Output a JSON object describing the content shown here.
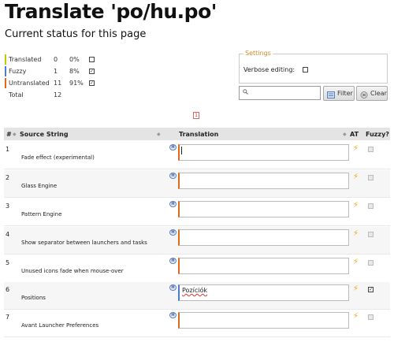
{
  "page": {
    "title": "Translate 'po/hu.po'",
    "subtitle": "Current status for this page"
  },
  "stats": [
    {
      "label": "Translated",
      "count": "0",
      "percent": "0%",
      "checked": "",
      "color": "#c8c800"
    },
    {
      "label": "Fuzzy",
      "count": "1",
      "percent": "8%",
      "checked": "✓",
      "color": "#4a7fd0"
    },
    {
      "label": "Untranslated",
      "count": "11",
      "percent": "91%",
      "checked": "✓",
      "color": "#e06a1a"
    },
    {
      "label": "Total",
      "count": "12",
      "percent": "",
      "checked": "",
      "color": ""
    }
  ],
  "settings": {
    "legend": "Settings",
    "verbose_label": "Verbose editing:"
  },
  "search": {
    "placeholder": "",
    "icon": "search-icon"
  },
  "buttons": {
    "filter": "Filter",
    "clear": "Clear"
  },
  "pager": {
    "current_page": "1"
  },
  "table": {
    "headers": {
      "num": "#",
      "source": "Source String",
      "translation": "Translation",
      "at": "AT",
      "fuzzy": "Fuzzy?"
    },
    "rows": [
      {
        "num": "1",
        "source": "Fade effect (experimental)",
        "translation": "",
        "fuzzy": ""
      },
      {
        "num": "2",
        "source": "Glass Engine",
        "translation": "",
        "fuzzy": ""
      },
      {
        "num": "3",
        "source": "Pattern Engine",
        "translation": "",
        "fuzzy": ""
      },
      {
        "num": "4",
        "source": "Show separator between launchers and tasks",
        "translation": "",
        "fuzzy": ""
      },
      {
        "num": "5",
        "source": "Unused icons fade when mouse-over",
        "translation": "",
        "fuzzy": ""
      },
      {
        "num": "6",
        "source": "Positions",
        "translation": "Pozíciók",
        "fuzzy": "✓"
      },
      {
        "num": "7",
        "source": "Avant Launcher Preferences",
        "translation": "",
        "fuzzy": ""
      }
    ]
  },
  "colors": {
    "accent_orange": "#e06a1a",
    "settings_legend": "#d38b2b",
    "bolt": "#f0a60a"
  }
}
